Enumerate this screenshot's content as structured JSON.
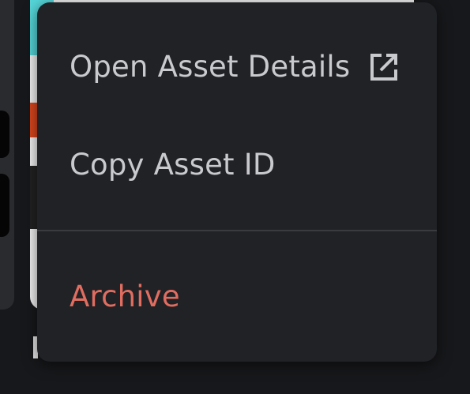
{
  "menu": {
    "items": [
      {
        "label": "Open Asset Details",
        "icon": "external-link-icon"
      },
      {
        "label": "Copy Asset ID"
      },
      {
        "label": "Archive",
        "color": "#e06d60"
      }
    ]
  },
  "colors": {
    "menu_background": "#212226",
    "menu_text": "#c9cacd",
    "danger_text": "#e06d60",
    "divider": "#3a3b3f"
  }
}
